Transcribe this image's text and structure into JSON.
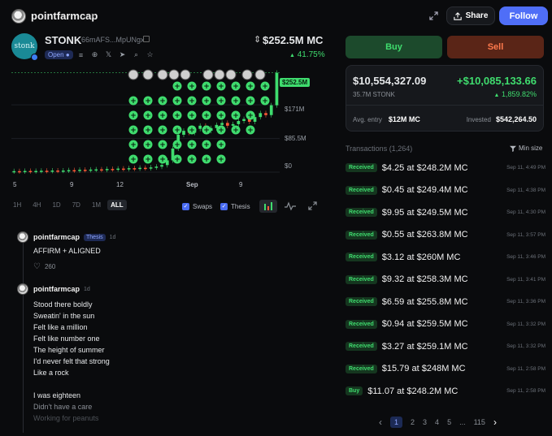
{
  "header": {
    "username": "pointfarmcap",
    "share_label": "Share",
    "follow_label": "Follow"
  },
  "token": {
    "logo_text": "stonk",
    "ticker": "STONK",
    "address": "66mAFS...MpUNgx",
    "status": "Open",
    "market_cap": "$252.5M MC",
    "change": "41.75%"
  },
  "chart": {
    "price_label": "$252.5M",
    "y_ticks": [
      "$171M",
      "$85.5M",
      "$0"
    ],
    "x_ticks": [
      "5",
      "9",
      "12",
      "Sep",
      "9"
    ],
    "ranges": [
      "1H",
      "4H",
      "1D",
      "7D",
      "1M",
      "ALL"
    ],
    "active_range": "ALL",
    "swaps_label": "Swaps",
    "thesis_label": "Thesis"
  },
  "chart_data": {
    "type": "candlestick",
    "ylim": [
      0,
      260000000
    ],
    "y_ticks": [
      "$171M",
      "$85.5M",
      "$0"
    ],
    "x_ticks": [
      "5",
      "9",
      "12",
      "Sep",
      "9"
    ],
    "candles_mc_millions": [
      [
        2,
        2.5
      ],
      [
        2.5,
        2
      ],
      [
        2,
        3
      ],
      [
        3,
        2.5
      ],
      [
        2.5,
        3
      ],
      [
        3,
        3.5
      ],
      [
        3.5,
        3
      ],
      [
        3,
        4
      ],
      [
        4,
        3.5
      ],
      [
        3.5,
        4
      ],
      [
        4,
        5
      ],
      [
        5,
        4.5
      ],
      [
        4.5,
        6
      ],
      [
        6,
        5.5
      ],
      [
        5.5,
        6.5
      ],
      [
        6.5,
        7
      ],
      [
        7,
        6
      ],
      [
        6,
        8
      ],
      [
        8,
        7.5
      ],
      [
        7.5,
        9
      ],
      [
        9,
        8
      ],
      [
        8,
        10
      ],
      [
        10,
        9
      ],
      [
        9,
        11
      ],
      [
        11,
        10
      ],
      [
        10,
        12
      ],
      [
        12,
        14
      ],
      [
        14,
        18
      ],
      [
        18,
        30
      ],
      [
        30,
        60
      ],
      [
        60,
        95
      ],
      [
        95,
        105
      ],
      [
        105,
        100
      ],
      [
        100,
        110
      ],
      [
        110,
        118
      ],
      [
        118,
        105
      ],
      [
        105,
        112
      ],
      [
        112,
        120
      ],
      [
        120,
        125
      ],
      [
        125,
        118
      ],
      [
        118,
        122
      ],
      [
        122,
        130
      ],
      [
        130,
        135
      ],
      [
        135,
        128
      ],
      [
        128,
        140
      ],
      [
        140,
        150
      ],
      [
        150,
        145
      ],
      [
        145,
        170
      ],
      [
        170,
        252.5
      ]
    ]
  },
  "feed": {
    "posts": [
      {
        "name": "pointfarmcap",
        "tag": "Thesis",
        "time": "1d",
        "lines": [
          "AFFIRM + ALIGNED"
        ],
        "likes": "260"
      },
      {
        "name": "pointfarmcap",
        "time": "1d",
        "lines": [
          "Stood there boldly",
          "Sweatin' in the sun",
          "Felt like a million",
          "Felt like number one",
          "The height of summer",
          "I'd never felt that strong",
          "Like a rock",
          "",
          "I was eighteen",
          "Didn't have a care",
          "Working for peanuts"
        ]
      }
    ]
  },
  "trade": {
    "buy_label": "Buy",
    "sell_label": "Sell"
  },
  "position": {
    "value": "$10,554,327.09",
    "gain": "+$10,085,133.66",
    "amount": "35.7M STONK",
    "gain_pct": "1,859.82%",
    "avg_entry_label": "Avg. entry",
    "avg_entry_value": "$12M MC",
    "invested_label": "Invested",
    "invested_value": "$542,264.50"
  },
  "transactions": {
    "title": "Transactions (1,264)",
    "min_size_label": "Min size",
    "rows": [
      {
        "type": "Received",
        "amount": "$4.25",
        "at": "at",
        "mc": "$248.2M",
        "unit": "MC",
        "time": "Sep 11, 4:49 PM"
      },
      {
        "type": "Received",
        "amount": "$0.45",
        "at": "at",
        "mc": "$249.4M",
        "unit": "MC",
        "time": "Sep 11, 4:38 PM"
      },
      {
        "type": "Received",
        "amount": "$9.95",
        "at": "at",
        "mc": "$249.5M",
        "unit": "MC",
        "time": "Sep 11, 4:30 PM"
      },
      {
        "type": "Received",
        "amount": "$0.55",
        "at": "at",
        "mc": "$263.8M",
        "unit": "MC",
        "time": "Sep 11, 3:57 PM"
      },
      {
        "type": "Received",
        "amount": "$3.12",
        "at": "at",
        "mc": "$260M",
        "unit": "MC",
        "time": "Sep 11, 3:46 PM"
      },
      {
        "type": "Received",
        "amount": "$9.32",
        "at": "at",
        "mc": "$258.3M",
        "unit": "MC",
        "time": "Sep 11, 3:41 PM"
      },
      {
        "type": "Received",
        "amount": "$6.59",
        "at": "at",
        "mc": "$255.8M",
        "unit": "MC",
        "time": "Sep 11, 3:36 PM"
      },
      {
        "type": "Received",
        "amount": "$0.94",
        "at": "at",
        "mc": "$259.5M",
        "unit": "MC",
        "time": "Sep 11, 3:32 PM"
      },
      {
        "type": "Received",
        "amount": "$3.27",
        "at": "at",
        "mc": "$259.1M",
        "unit": "MC",
        "time": "Sep 11, 3:32 PM"
      },
      {
        "type": "Received",
        "amount": "$15.79",
        "at": "at",
        "mc": "$248M",
        "unit": "MC",
        "time": "Sep 11, 2:58 PM"
      },
      {
        "type": "Buy",
        "amount": "$11.07",
        "at": "at",
        "mc": "$248.2M",
        "unit": "MC",
        "time": "Sep 11, 2:58 PM"
      }
    ]
  },
  "pagination": {
    "prev": "‹",
    "pages": [
      "1",
      "2",
      "3",
      "4",
      "5",
      "...",
      "115"
    ],
    "next": "›"
  },
  "colors": {
    "up": "#3fdc6e",
    "down": "#ff5a36",
    "accent": "#4f6ef7"
  }
}
